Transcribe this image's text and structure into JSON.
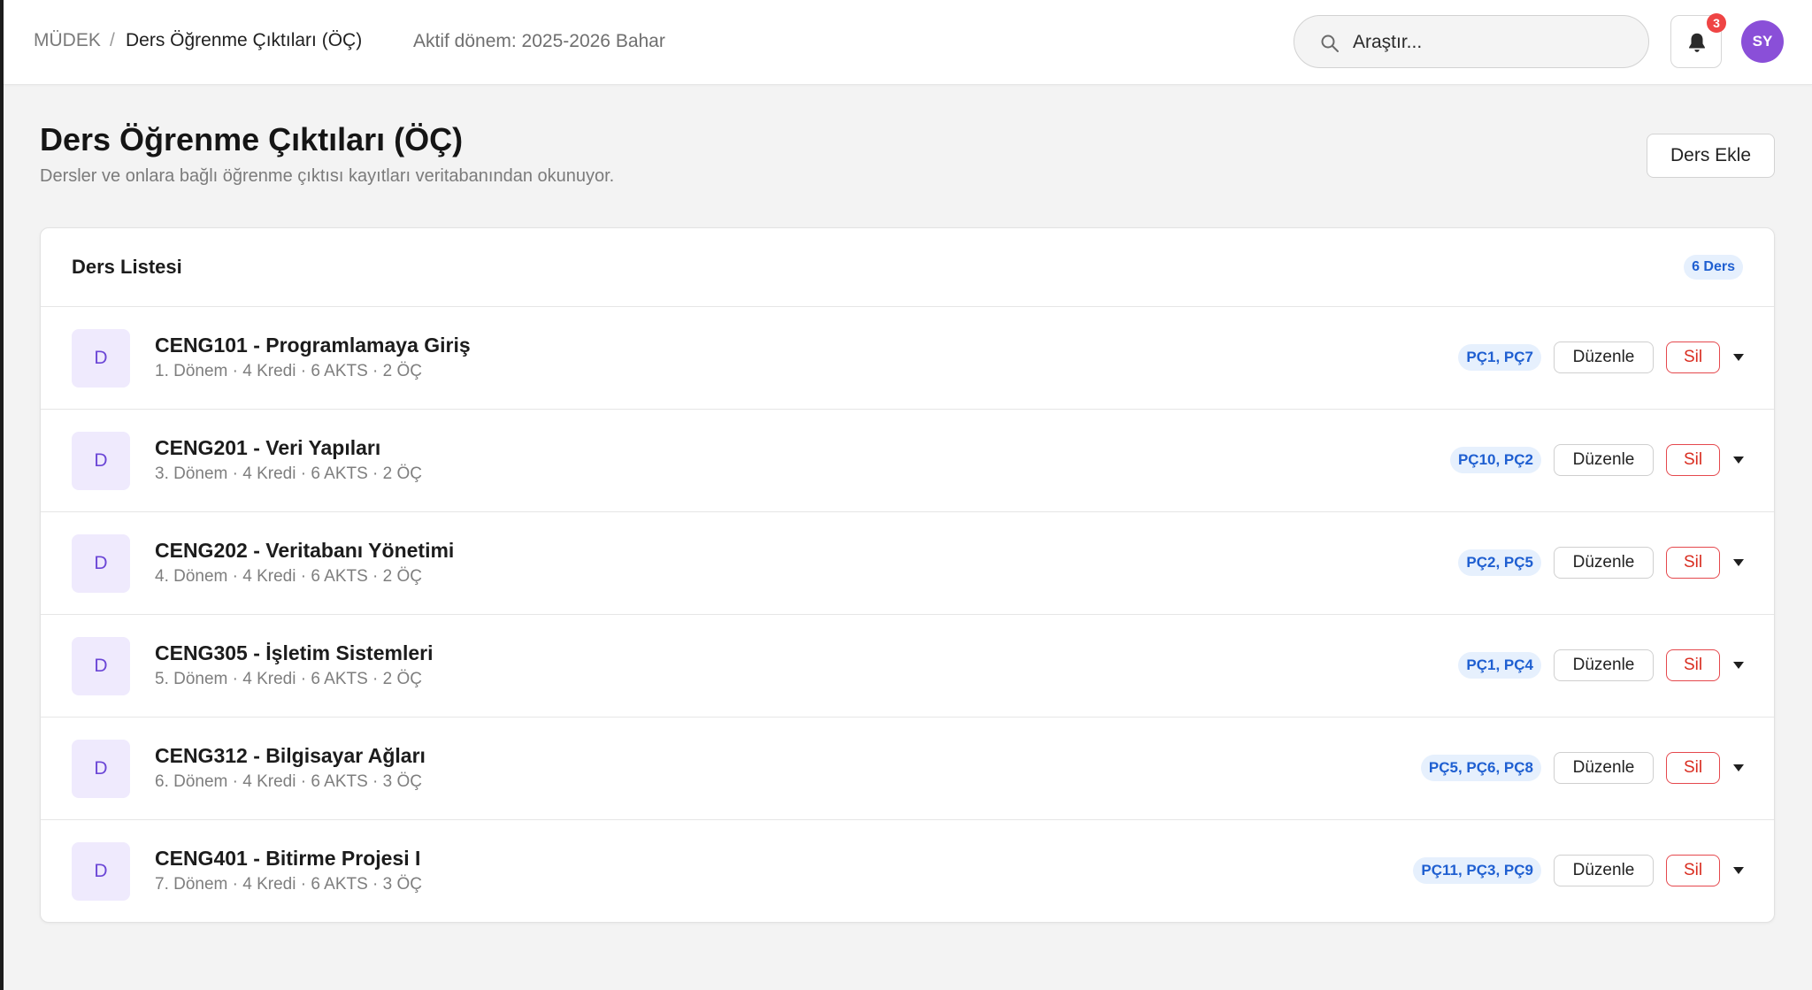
{
  "breadcrumb": {
    "root": "MÜDEK",
    "separator": "/",
    "current": "Ders Öğrenme Çıktıları (ÖÇ)"
  },
  "term": "Aktif dönem: 2025-2026 Bahar",
  "search": {
    "placeholder": "Araştır..."
  },
  "notifications": {
    "count": "3"
  },
  "user": {
    "initials": "SY"
  },
  "page": {
    "title": "Ders Öğrenme Çıktıları (ÖÇ)",
    "subtitle": "Dersler ve onlara bağlı öğrenme çıktısı kayıtları veritabanından okunuyor.",
    "add_button": "Ders Ekle"
  },
  "card": {
    "title": "Ders Listesi",
    "count_badge": "6 Ders",
    "edit_label": "Düzenle",
    "delete_label": "Sil"
  },
  "courses": [
    {
      "icon_letter": "D",
      "name": "CENG101 - Programlamaya Giriş",
      "meta": "1. Dönem · 4 Kredi · 6 AKTS · 2 ÖÇ",
      "outcomes": "PÇ1, PÇ7"
    },
    {
      "icon_letter": "D",
      "name": "CENG201 - Veri Yapıları",
      "meta": "3. Dönem · 4 Kredi · 6 AKTS · 2 ÖÇ",
      "outcomes": "PÇ10, PÇ2"
    },
    {
      "icon_letter": "D",
      "name": "CENG202 - Veritabanı Yönetimi",
      "meta": "4. Dönem · 4 Kredi · 6 AKTS · 2 ÖÇ",
      "outcomes": "PÇ2, PÇ5"
    },
    {
      "icon_letter": "D",
      "name": "CENG305 - İşletim Sistemleri",
      "meta": "5. Dönem · 4 Kredi · 6 AKTS · 2 ÖÇ",
      "outcomes": "PÇ1, PÇ4"
    },
    {
      "icon_letter": "D",
      "name": "CENG312 - Bilgisayar Ağları",
      "meta": "6. Dönem · 4 Kredi · 6 AKTS · 3 ÖÇ",
      "outcomes": "PÇ5, PÇ6, PÇ8"
    },
    {
      "icon_letter": "D",
      "name": "CENG401 - Bitirme Projesi I",
      "meta": "7. Dönem · 4 Kredi · 6 AKTS · 3 ÖÇ",
      "outcomes": "PÇ11, PÇ3, PÇ9"
    }
  ],
  "colors": {
    "accent": "#1f5fd1",
    "danger": "#d92d20",
    "avatar": "#8a4fd8",
    "course_icon_bg": "#efeafd"
  }
}
